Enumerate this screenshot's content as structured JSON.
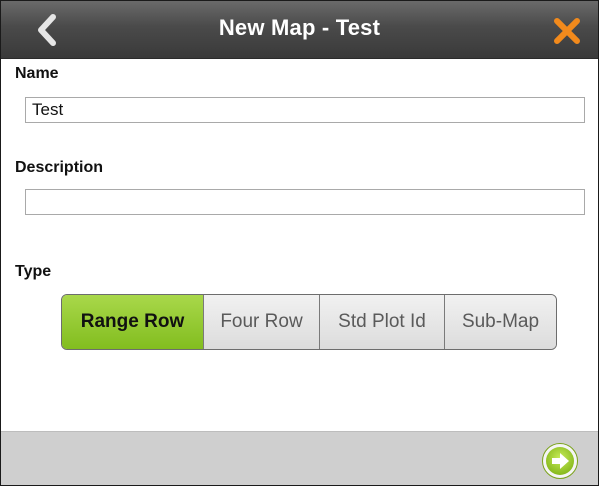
{
  "header": {
    "title": "New Map - Test",
    "back_icon": "chevron-left-icon",
    "close_icon": "close-x-icon",
    "close_color": "#f28a1c"
  },
  "form": {
    "name_label": "Name",
    "name_value": "Test",
    "description_label": "Description",
    "description_value": "",
    "type_label": "Type",
    "type_options": [
      "Range Row",
      "Four Row",
      "Std Plot Id",
      "Sub-Map"
    ],
    "type_selected": "Range Row"
  },
  "footer": {
    "next_icon": "arrow-right-circle-icon",
    "next_color": "#9ccc2b"
  },
  "colors": {
    "accent_green": "#8cc63f",
    "header_bg": "#4a4a4a",
    "footer_bg": "#cfcfcf"
  }
}
